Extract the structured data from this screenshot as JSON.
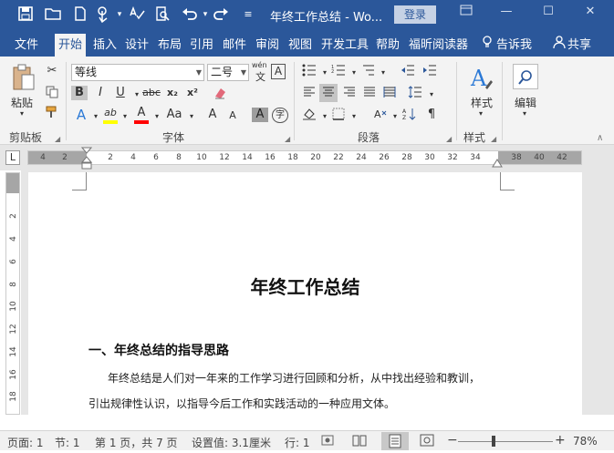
{
  "titlebar": {
    "doc_title": "年终工作总结 - Wo...",
    "login_label": "登录",
    "quick_access": {
      "save": "save-icon",
      "open": "folder-icon",
      "new": "new-doc-icon",
      "touch": "touch-mode-icon",
      "spell": "spellcheck-icon",
      "preview": "print-preview-icon",
      "undo": "undo-icon",
      "redo": "redo-icon",
      "customize": "customize-qat-icon"
    }
  },
  "menu": {
    "tabs": [
      "文件",
      "开始",
      "插入",
      "设计",
      "布局",
      "引用",
      "邮件",
      "审阅",
      "视图",
      "开发工具",
      "帮助",
      "福昕阅读器"
    ],
    "active": "开始",
    "tell_me": "告诉我",
    "share": "共享"
  },
  "ribbon": {
    "clipboard": {
      "label": "剪贴板",
      "paste": "粘贴"
    },
    "font": {
      "label": "字体",
      "font_name": "等线",
      "font_size": "二号",
      "wen": "wén",
      "wen_char": "文",
      "bold": "B",
      "italic": "I",
      "underline": "U",
      "strike": "abc",
      "sub": "x₂",
      "sup": "x²",
      "effects": "A",
      "highlight": "ab",
      "font_color": "A",
      "case": "Aa",
      "grow": "A",
      "shrink": "A",
      "char_shade": "A",
      "enclose": "字"
    },
    "paragraph": {
      "label": "段落"
    },
    "styles": {
      "label": "样式",
      "button": "样式"
    },
    "editing": {
      "button": "编辑"
    }
  },
  "ruler": {
    "corner": "L",
    "h_left_ticks": [
      "4",
      "2"
    ],
    "h_ticks": [
      "2",
      "4",
      "6",
      "8",
      "10",
      "12",
      "14",
      "16",
      "18",
      "20",
      "22",
      "24",
      "26",
      "28",
      "30",
      "32",
      "34"
    ],
    "h_right_ticks": [
      "38",
      "40",
      "42"
    ],
    "v_ticks": [
      "2",
      "4",
      "6",
      "8",
      "10",
      "12",
      "14",
      "16",
      "18"
    ]
  },
  "document": {
    "title": "年终工作总结",
    "heading1": "一、年终总结的指导思路",
    "para1_line1": "年终总结是人们对一年来的工作学习进行回顾和分析，从中找出经验和教训，",
    "para1_line2": "引出规律性认识，以指导今后工作和实践活动的一种应用文体。"
  },
  "status": {
    "page": "页面: 1",
    "section": "节: 1",
    "page_of": "第 1 页，共 7 页",
    "setting": "设置值: 3.1厘米",
    "line": "行: 1",
    "zoom": "78%",
    "zoom_fraction": 0.78
  },
  "colors": {
    "accent": "#2b579a",
    "highlight_yellow": "#ffff00",
    "font_red": "#ff0000"
  }
}
